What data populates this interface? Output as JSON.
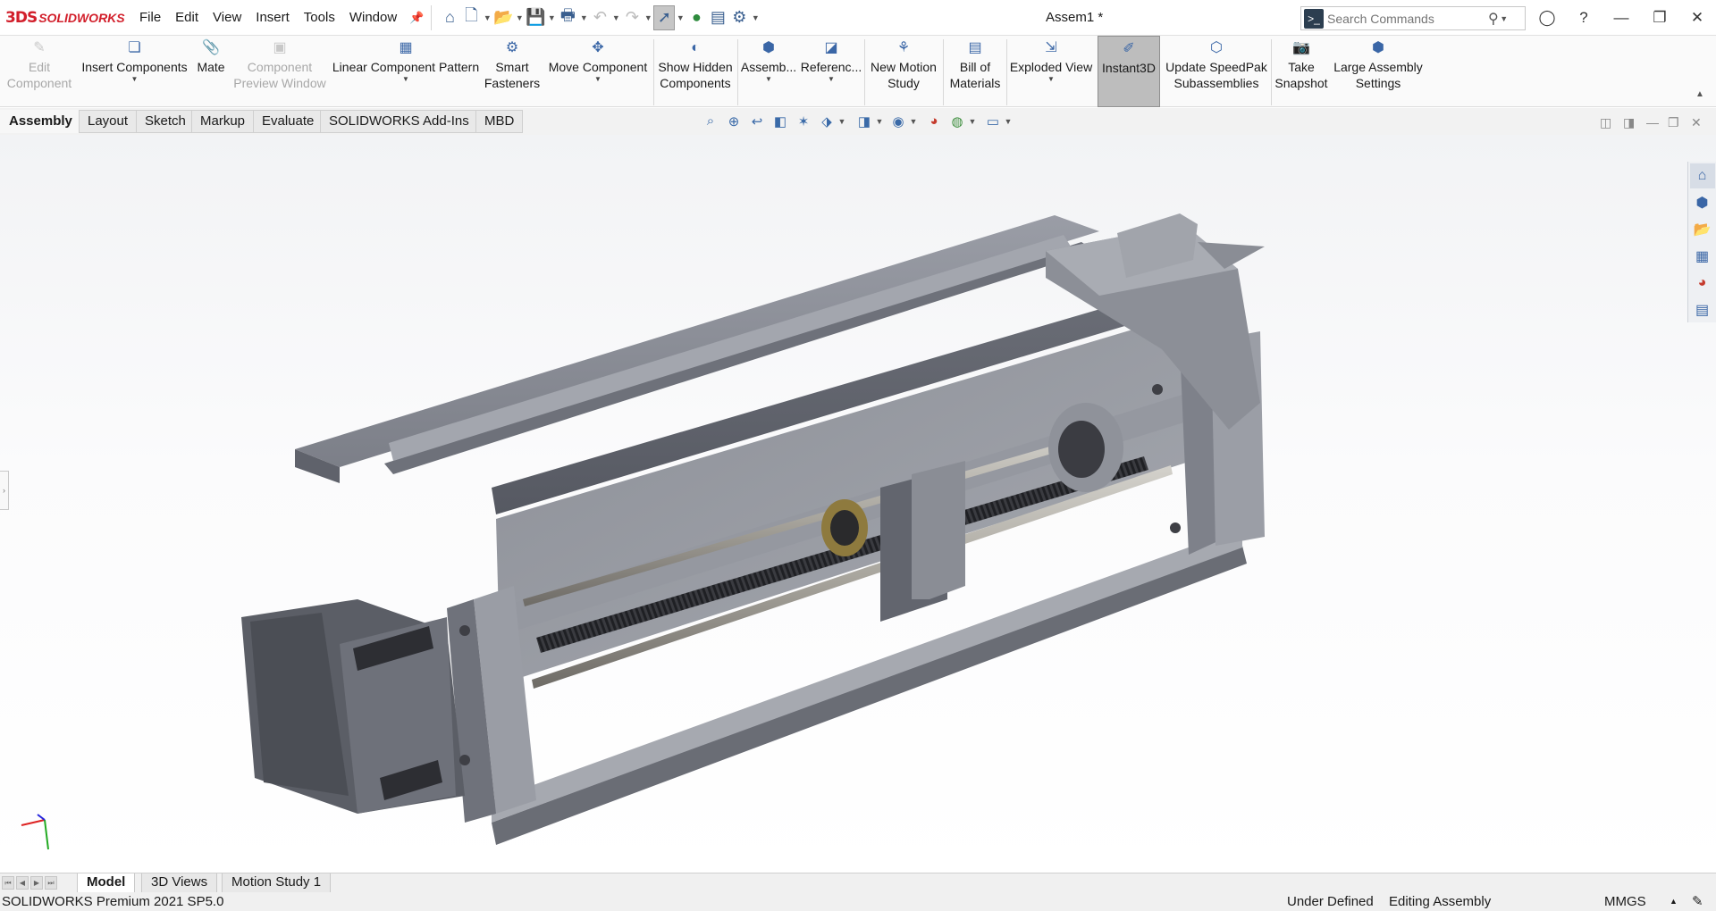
{
  "app": {
    "logo_mark": "3DS",
    "logo_text": "SOLIDWORKS",
    "document_title": "Assem1 *"
  },
  "menu": [
    "File",
    "Edit",
    "View",
    "Insert",
    "Tools",
    "Window"
  ],
  "search": {
    "placeholder": "Search Commands"
  },
  "ribbon": {
    "edit_component": [
      "Edit",
      "Component"
    ],
    "insert_components": "Insert Components",
    "mate": "Mate",
    "component_preview": [
      "Component",
      "Preview Window"
    ],
    "linear_pattern": "Linear Component Pattern",
    "smart_fasteners": [
      "Smart",
      "Fasteners"
    ],
    "move_component": "Move Component",
    "show_hidden": [
      "Show Hidden",
      "Components"
    ],
    "assembly_features": "Assemb...",
    "reference_geometry": "Referenc...",
    "new_motion_study": [
      "New Motion",
      "Study"
    ],
    "bill_of_materials": [
      "Bill of",
      "Materials"
    ],
    "exploded_view": "Exploded View",
    "instant3d": "Instant3D",
    "update_speedpak": [
      "Update SpeedPak",
      "Subassemblies"
    ],
    "take_snapshot": [
      "Take",
      "Snapshot"
    ],
    "large_assembly": [
      "Large Assembly",
      "Settings"
    ]
  },
  "tabs": [
    "Assembly",
    "Layout",
    "Sketch",
    "Markup",
    "Evaluate",
    "SOLIDWORKS Add-Ins",
    "MBD"
  ],
  "bottom_tabs": [
    "Model",
    "3D Views",
    "Motion Study 1"
  ],
  "status": {
    "version": "SOLIDWORKS Premium 2021 SP5.0",
    "definition": "Under Defined",
    "mode": "Editing Assembly",
    "units": "MMGS",
    "units_caret": "▲"
  },
  "colors": {
    "brand_red": "#d21f2b",
    "accent_blue": "#3a66a6",
    "model_gray": "#7d8089"
  },
  "icons": {
    "home": "home-icon",
    "new": "new-document-icon",
    "open": "open-folder-icon",
    "save": "save-icon",
    "print": "print-icon",
    "undo": "undo-icon",
    "redo": "redo-icon",
    "select": "select-arrow-icon",
    "rebuild": "rebuild-traffic-light-icon",
    "file_props": "file-properties-icon",
    "options": "gear-icon"
  }
}
